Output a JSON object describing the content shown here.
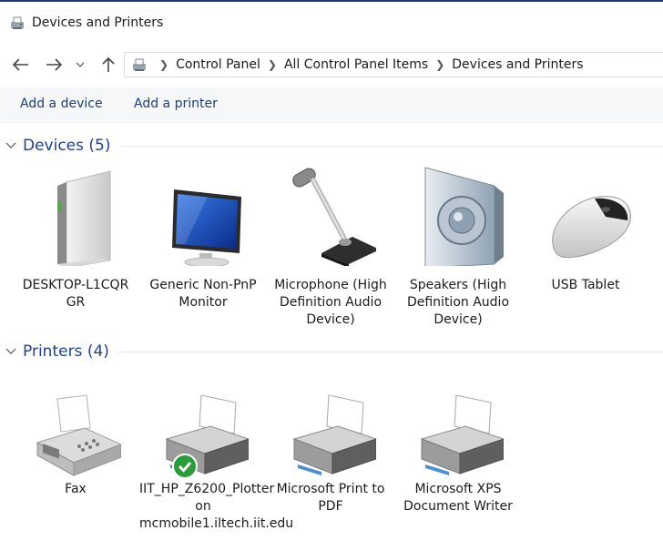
{
  "window": {
    "title": "Devices and Printers"
  },
  "address": {
    "crumbs": [
      "Control Panel",
      "All Control Panel Items",
      "Devices and Printers"
    ]
  },
  "commands": {
    "add_device": "Add a device",
    "add_printer": "Add a printer"
  },
  "groups": {
    "devices": {
      "title": "Devices (5)",
      "items": [
        {
          "label": "DESKTOP-L1CQR GR",
          "icon": "computer-tower-icon"
        },
        {
          "label": "Generic Non-PnP Monitor",
          "icon": "monitor-icon"
        },
        {
          "label": "Microphone (High Definition Audio Device)",
          "icon": "microphone-icon"
        },
        {
          "label": "Speakers (High Definition Audio Device)",
          "icon": "speaker-icon"
        },
        {
          "label": "USB Tablet",
          "icon": "mouse-icon"
        }
      ]
    },
    "printers": {
      "title": "Printers (4)",
      "items": [
        {
          "label": "Fax",
          "icon": "fax-icon"
        },
        {
          "label": "IIT_HP_Z6200_Plotter on mcmobile1.iltech.iit.edu",
          "icon": "printer-icon",
          "default": true
        },
        {
          "label": "Microsoft Print to PDF",
          "icon": "printer-icon"
        },
        {
          "label": "Microsoft XPS Document Writer",
          "icon": "printer-icon"
        }
      ]
    }
  }
}
